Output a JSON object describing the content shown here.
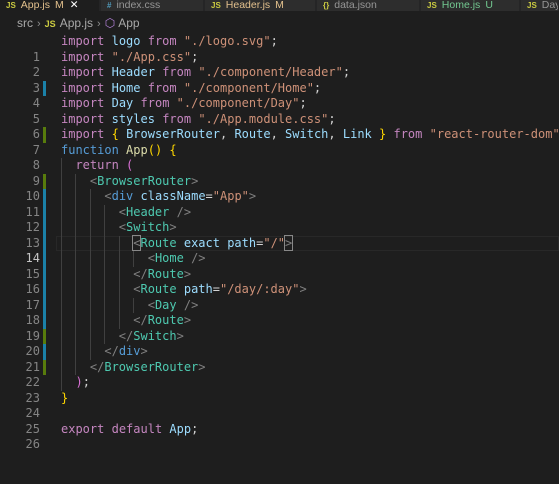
{
  "tabs": [
    {
      "icon": "JS",
      "name": "App.js",
      "status": "M",
      "active": true
    },
    {
      "icon": "#",
      "name": "index.css",
      "status": ""
    },
    {
      "icon": "JS",
      "name": "Header.js",
      "status": "M"
    },
    {
      "icon": "{}",
      "name": "data.json",
      "status": ""
    },
    {
      "icon": "JS",
      "name": "Home.js",
      "status": "U"
    },
    {
      "icon": "JS",
      "name": "Day",
      "status": ""
    }
  ],
  "breadcrumb": {
    "folder": "src",
    "file_icon": "JS",
    "file": "App.js",
    "symbol": "App"
  },
  "lines": [
    {
      "n": "1",
      "git": ""
    },
    {
      "n": "2",
      "git": ""
    },
    {
      "n": "3",
      "git": ""
    },
    {
      "n": "4",
      "git": "modified"
    },
    {
      "n": "5",
      "git": ""
    },
    {
      "n": "6",
      "git": ""
    },
    {
      "n": "7",
      "git": "added"
    },
    {
      "n": "8",
      "git": ""
    },
    {
      "n": "9",
      "git": ""
    },
    {
      "n": "10",
      "git": "added"
    },
    {
      "n": "11",
      "git": "modified"
    },
    {
      "n": "12",
      "git": "modified"
    },
    {
      "n": "13",
      "git": "modified"
    },
    {
      "n": "14",
      "git": "modified"
    },
    {
      "n": "15",
      "git": "modified"
    },
    {
      "n": "16",
      "git": "modified"
    },
    {
      "n": "17",
      "git": "modified"
    },
    {
      "n": "18",
      "git": "modified"
    },
    {
      "n": "19",
      "git": "modified"
    },
    {
      "n": "20",
      "git": "added"
    },
    {
      "n": "21",
      "git": "modified"
    },
    {
      "n": "22",
      "git": "added"
    },
    {
      "n": "23",
      "git": ""
    },
    {
      "n": "24",
      "git": ""
    },
    {
      "n": "25",
      "git": ""
    },
    {
      "n": "26",
      "git": ""
    }
  ],
  "code": {
    "l1": {
      "k": "import",
      "v": "logo",
      "from": "from",
      "s": "\"./logo.svg\"",
      "p": ";"
    },
    "l2": {
      "k": "import",
      "s": "\"./App.css\"",
      "p": ";"
    },
    "l3": {
      "k": "import",
      "v": "Header",
      "from": "from",
      "s": "\"./component/Header\"",
      "p": ";"
    },
    "l4": {
      "k": "import",
      "v": "Home",
      "from": "from",
      "s": "\"./component/Home\"",
      "p": ";"
    },
    "l5": {
      "k": "import",
      "v": "Day",
      "from": "from",
      "s": "\"./component/Day\"",
      "p": ";"
    },
    "l6": {
      "k": "import",
      "v": "styles",
      "from": "from",
      "s": "\"./App.module.css\"",
      "p": ";"
    },
    "l7": {
      "k": "import",
      "ob": "{",
      "v1": "BrowserRouter",
      "c1": ",",
      "v2": "Route",
      "c2": ",",
      "v3": "Switch",
      "c3": ",",
      "v4": "Link",
      "cb": "}",
      "from": "from",
      "s": "\"react-router-dom\"",
      "p": ";"
    },
    "l8": {
      "k": "function",
      "fn": "App",
      "par": "()",
      "ob": "{"
    },
    "l9": {
      "k": "return",
      "ob": "("
    },
    "l10": {
      "lt": "<",
      "t": "BrowserRouter",
      "gt": ">"
    },
    "l11": {
      "lt": "<",
      "t": "div",
      "a": "className",
      "eq": "=",
      "s": "\"App\"",
      "gt": ">"
    },
    "l12": {
      "lt": "<",
      "t": "Header",
      "gt": "/>"
    },
    "l13": {
      "lt": "<",
      "t": "Switch",
      "gt": ">"
    },
    "l14": {
      "lt": "<",
      "t": "Route",
      "a1": "exact",
      "a2": "path",
      "eq": "=",
      "s": "\"/\"",
      "gt": ">"
    },
    "l15": {
      "lt": "<",
      "t": "Home",
      "gt": "/>"
    },
    "l16": {
      "lt": "</",
      "t": "Route",
      "gt": ">"
    },
    "l17": {
      "lt": "<",
      "t": "Route",
      "a": "path",
      "eq": "=",
      "s": "\"/day/:day\"",
      "gt": ">"
    },
    "l18": {
      "lt": "<",
      "t": "Day",
      "gt": "/>"
    },
    "l19": {
      "lt": "</",
      "t": "Route",
      "gt": ">"
    },
    "l20": {
      "lt": "</",
      "t": "Switch",
      "gt": ">"
    },
    "l21": {
      "lt": "</",
      "t": "div",
      "gt": ">"
    },
    "l22": {
      "lt": "</",
      "t": "BrowserRouter",
      "gt": ">"
    },
    "l23": {
      "cp": ")",
      "p": ";"
    },
    "l24": {
      "cb": "}"
    },
    "l26": {
      "k1": "export",
      "k2": "default",
      "v": "App",
      "p": ";"
    }
  },
  "colors": {
    "background": "#1e1e1e",
    "tabbar": "#252526",
    "modified": "#1b81a8",
    "added": "#587c0c"
  }
}
